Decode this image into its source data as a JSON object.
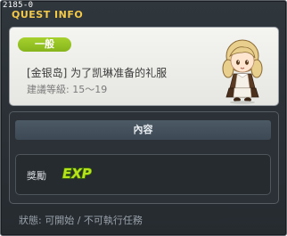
{
  "header": {
    "quest_id": "2185-0",
    "title": "QUEST INFO"
  },
  "quest": {
    "category": "一般",
    "name": "[金银岛] 为了凯琳准备的礼服",
    "level_requirement": "建議等級: 15～19"
  },
  "content": {
    "header_label": "內容",
    "reward_label": "獎勵",
    "reward_icon": "exp-icon",
    "reward_icon_text": "EXP"
  },
  "status": {
    "text": "狀態: 可開始 / 不可執行任務"
  },
  "colors": {
    "title": "#f3c94a",
    "badge": "#9ac625",
    "exp_green": "#b7e31d"
  }
}
